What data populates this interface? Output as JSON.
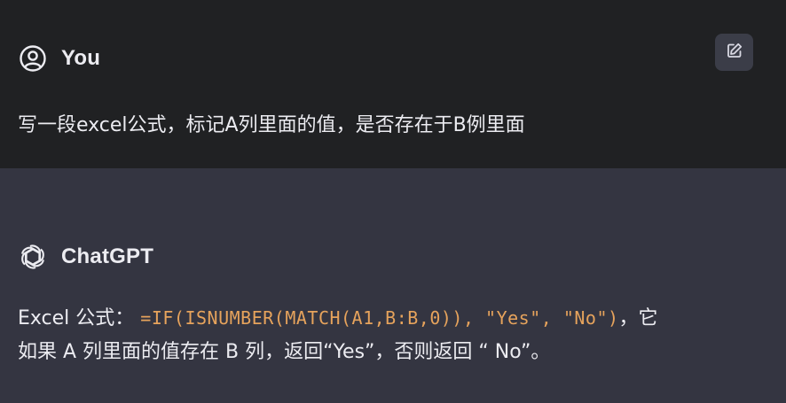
{
  "user": {
    "name": "You",
    "message": "写一段excel公式，标记A列里面的值，是否存在于B例里面"
  },
  "assistant": {
    "name": "ChatGPT",
    "line1_prefix": "Excel 公式：",
    "formula": "=IF(ISNUMBER(MATCH(A1,B:B,0)), \"Yes\", \"No\")",
    "line1_suffix": "，它",
    "line2": "如果 A 列里面的值存在 B 列，返回“Yes”，否则返回 “ No”。"
  },
  "icons": {
    "user_avatar": "user-circle-icon",
    "assistant_avatar": "openai-logo-icon",
    "edit": "pencil-icon"
  },
  "colors": {
    "user_bg": "#202123",
    "assistant_bg": "#343541",
    "text": "#ececf1",
    "code": "#e6a35c"
  }
}
